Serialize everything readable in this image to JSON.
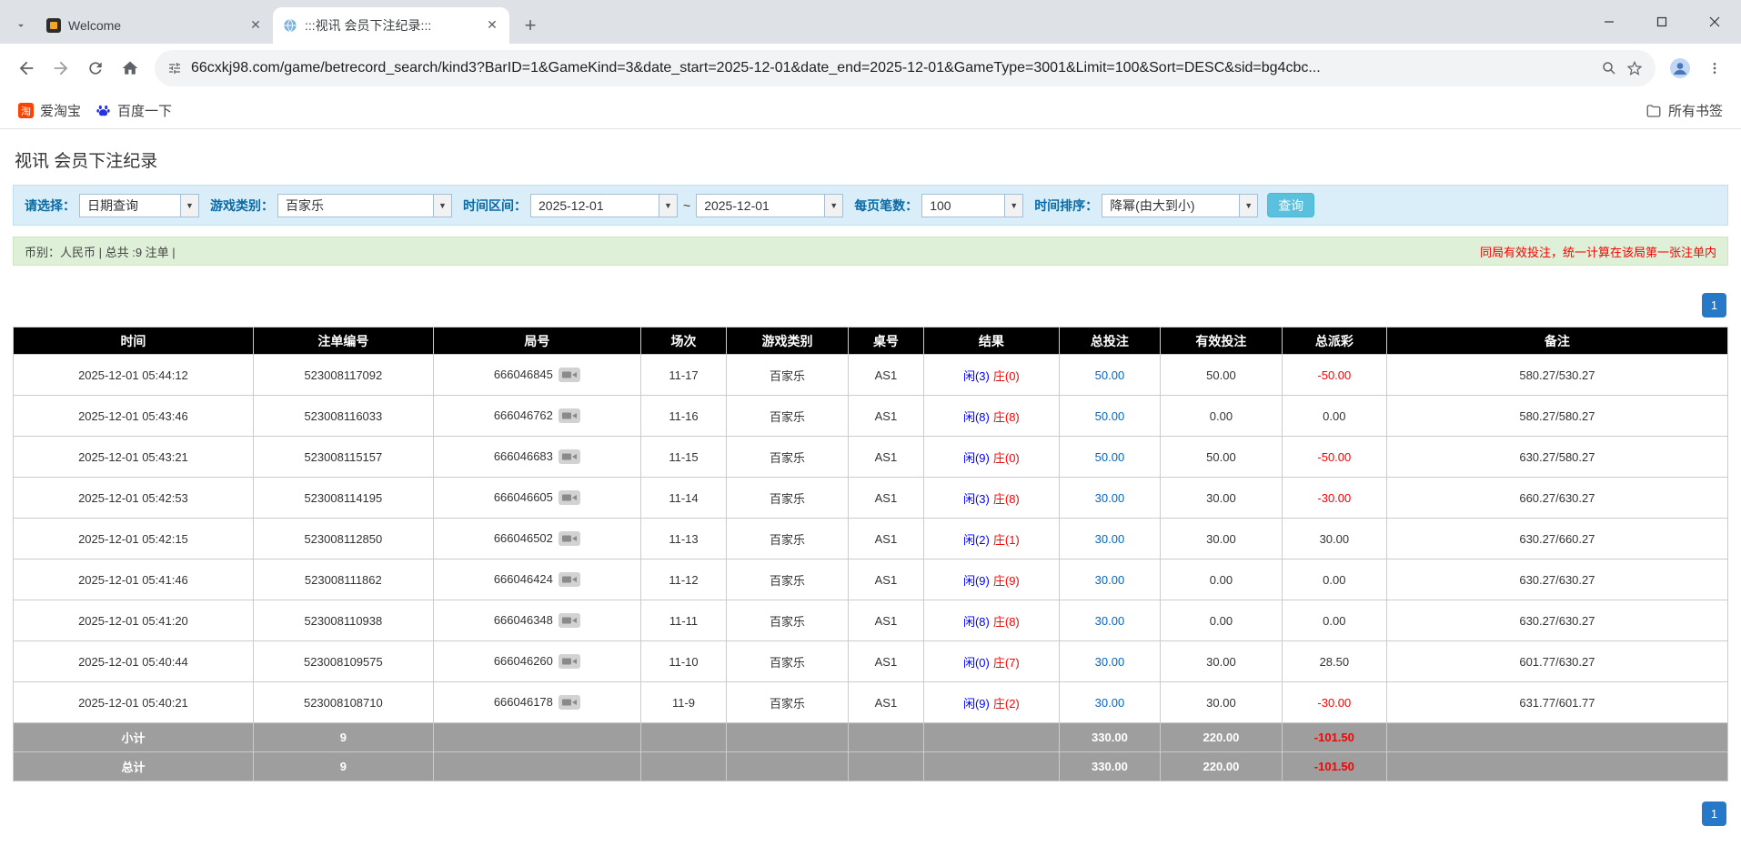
{
  "colors": {
    "link_blue": "#0066cc",
    "player_blue": "#0000ff",
    "banker_red": "#ff0000",
    "negative_red": "#ff0000",
    "pager_blue": "#2878c8",
    "search_button_teal": "#5bc0de",
    "filter_bar_bg": "#d9eef8",
    "info_bar_bg": "#dff0d8",
    "table_header_bg": "#000000",
    "table_footer_bg": "#9e9e9e"
  },
  "browser": {
    "tabs": [
      {
        "title": "Welcome"
      },
      {
        "title": ":::视讯 会员下注纪录:::"
      }
    ],
    "url": "66cxkj98.com/game/betrecord_search/kind3?BarID=1&GameKind=3&date_start=2025-12-01&date_end=2025-12-01&GameType=3001&Limit=100&Sort=DESC&sid=bg4cbc...",
    "bookmarks": [
      {
        "label": "爱淘宝"
      },
      {
        "label": "百度一下"
      }
    ],
    "all_bookmarks_label": "所有书签"
  },
  "page": {
    "title": "视讯 会员下注纪录",
    "filters": {
      "select_label": "请选择：",
      "select_value": "日期查询",
      "game_type_label": "游戏类别：",
      "game_type_value": "百家乐",
      "date_range_label": "时间区间：",
      "date_start": "2025-12-01",
      "date_separator": "~",
      "date_end": "2025-12-01",
      "per_page_label": "每页笔数：",
      "per_page_value": "100",
      "sort_label": "时间排序：",
      "sort_value": "降幂(由大到小)",
      "search_button": "查询"
    },
    "info": {
      "summary": "币别：人民币 | 总共 :9 注单 |",
      "notice": "同局有效投注，统一计算在该局第一张注单内"
    },
    "pagination": {
      "current": "1"
    },
    "table": {
      "headers": [
        "时间",
        "注单编号",
        "局号",
        "场次",
        "游戏类别",
        "桌号",
        "结果",
        "总投注",
        "有效投注",
        "总派彩",
        "备注"
      ],
      "rows": [
        {
          "time": "2025-12-01 05:44:12",
          "bet_id": "523008117092",
          "round_id": "666046845",
          "session": "11-17",
          "game": "百家乐",
          "table": "AS1",
          "result_player": "闲(3)",
          "result_banker": "庄(0)",
          "total_bet": "50.00",
          "valid_bet": "50.00",
          "payout": "-50.00",
          "note": "580.27/530.27"
        },
        {
          "time": "2025-12-01 05:43:46",
          "bet_id": "523008116033",
          "round_id": "666046762",
          "session": "11-16",
          "game": "百家乐",
          "table": "AS1",
          "result_player": "闲(8)",
          "result_banker": "庄(8)",
          "total_bet": "50.00",
          "valid_bet": "0.00",
          "payout": "0.00",
          "note": "580.27/580.27"
        },
        {
          "time": "2025-12-01 05:43:21",
          "bet_id": "523008115157",
          "round_id": "666046683",
          "session": "11-15",
          "game": "百家乐",
          "table": "AS1",
          "result_player": "闲(9)",
          "result_banker": "庄(0)",
          "total_bet": "50.00",
          "valid_bet": "50.00",
          "payout": "-50.00",
          "note": "630.27/580.27"
        },
        {
          "time": "2025-12-01 05:42:53",
          "bet_id": "523008114195",
          "round_id": "666046605",
          "session": "11-14",
          "game": "百家乐",
          "table": "AS1",
          "result_player": "闲(3)",
          "result_banker": "庄(8)",
          "total_bet": "30.00",
          "valid_bet": "30.00",
          "payout": "-30.00",
          "note": "660.27/630.27"
        },
        {
          "time": "2025-12-01 05:42:15",
          "bet_id": "523008112850",
          "round_id": "666046502",
          "session": "11-13",
          "game": "百家乐",
          "table": "AS1",
          "result_player": "闲(2)",
          "result_banker": "庄(1)",
          "total_bet": "30.00",
          "valid_bet": "30.00",
          "payout": "30.00",
          "note": "630.27/660.27"
        },
        {
          "time": "2025-12-01 05:41:46",
          "bet_id": "523008111862",
          "round_id": "666046424",
          "session": "11-12",
          "game": "百家乐",
          "table": "AS1",
          "result_player": "闲(9)",
          "result_banker": "庄(9)",
          "total_bet": "30.00",
          "valid_bet": "0.00",
          "payout": "0.00",
          "note": "630.27/630.27"
        },
        {
          "time": "2025-12-01 05:41:20",
          "bet_id": "523008110938",
          "round_id": "666046348",
          "session": "11-11",
          "game": "百家乐",
          "table": "AS1",
          "result_player": "闲(8)",
          "result_banker": "庄(8)",
          "total_bet": "30.00",
          "valid_bet": "0.00",
          "payout": "0.00",
          "note": "630.27/630.27"
        },
        {
          "time": "2025-12-01 05:40:44",
          "bet_id": "523008109575",
          "round_id": "666046260",
          "session": "11-10",
          "game": "百家乐",
          "table": "AS1",
          "result_player": "闲(0)",
          "result_banker": "庄(7)",
          "total_bet": "30.00",
          "valid_bet": "30.00",
          "payout": "28.50",
          "note": "601.77/630.27"
        },
        {
          "time": "2025-12-01 05:40:21",
          "bet_id": "523008108710",
          "round_id": "666046178",
          "session": "11-9",
          "game": "百家乐",
          "table": "AS1",
          "result_player": "闲(9)",
          "result_banker": "庄(2)",
          "total_bet": "30.00",
          "valid_bet": "30.00",
          "payout": "-30.00",
          "note": "631.77/601.77"
        }
      ],
      "subtotal": {
        "label": "小计",
        "count": "9",
        "total_bet": "330.00",
        "valid_bet": "220.00",
        "payout": "-101.50"
      },
      "total": {
        "label": "总计",
        "count": "9",
        "total_bet": "330.00",
        "valid_bet": "220.00",
        "payout": "-101.50"
      }
    }
  }
}
